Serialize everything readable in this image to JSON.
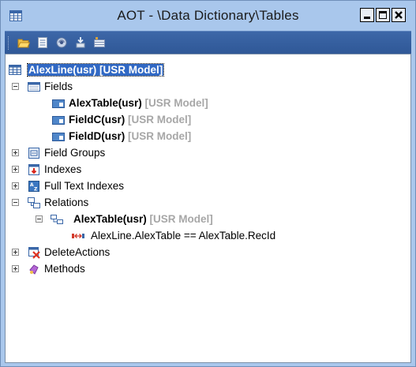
{
  "window": {
    "title": "AOT - \\Data Dictionary\\Tables"
  },
  "toolbar": {
    "buttons": [
      {
        "name": "open-folder-icon"
      },
      {
        "name": "properties-icon"
      },
      {
        "name": "compile-icon"
      },
      {
        "name": "import-icon"
      },
      {
        "name": "table-browser-icon"
      }
    ]
  },
  "tree": {
    "root": {
      "label": "AlexLine(usr)",
      "model": "[USR Model]"
    },
    "fields": {
      "label": "Fields",
      "items": [
        {
          "label": "AlexTable(usr)",
          "model": "[USR Model]"
        },
        {
          "label": "FieldC(usr)",
          "model": "[USR Model]"
        },
        {
          "label": "FieldD(usr)",
          "model": "[USR Model]"
        }
      ]
    },
    "field_groups": {
      "label": "Field Groups"
    },
    "indexes": {
      "label": "Indexes"
    },
    "full_text_indexes": {
      "label": "Full Text Indexes"
    },
    "relations": {
      "label": "Relations",
      "relation": {
        "label": "AlexTable(usr)",
        "model": "[USR Model]"
      },
      "condition": "AlexLine.AlexTable == AlexTable.RecId"
    },
    "delete_actions": {
      "label": "DeleteActions"
    },
    "methods": {
      "label": "Methods"
    }
  },
  "colors": {
    "selection": "#3068c4",
    "titlebar": "#a9c7ec",
    "toolbar": "#3d67a8",
    "model_text": "#a7a7a7"
  }
}
